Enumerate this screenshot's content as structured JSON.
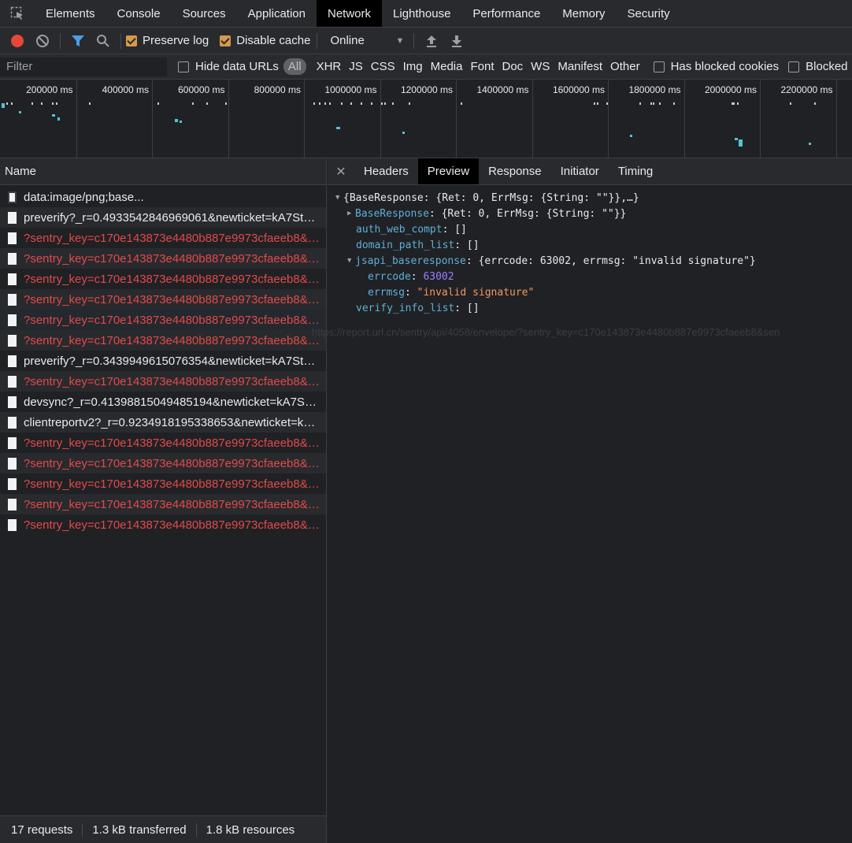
{
  "tabs": [
    "Elements",
    "Console",
    "Sources",
    "Application",
    "Network",
    "Lighthouse",
    "Performance",
    "Memory",
    "Security"
  ],
  "active_tab": "Network",
  "toolbar": {
    "preserve_log": "Preserve log",
    "disable_cache": "Disable cache",
    "throttle": "Online"
  },
  "filterbar": {
    "placeholder": "Filter",
    "hide_data_urls": "Hide data URLs",
    "types": [
      "All",
      "XHR",
      "JS",
      "CSS",
      "Img",
      "Media",
      "Font",
      "Doc",
      "WS",
      "Manifest",
      "Other"
    ],
    "has_blocked_cookies": "Has blocked cookies",
    "blocked": "Blocked"
  },
  "overview": {
    "labels": [
      "200000 ms",
      "400000 ms",
      "600000 ms",
      "800000 ms",
      "1000000 ms",
      "1200000 ms",
      "1400000 ms",
      "1600000 ms",
      "1800000 ms",
      "2000000 ms",
      "2200000 ms"
    ]
  },
  "requests": {
    "header": "Name",
    "rows": [
      {
        "name": "data:image/png;base...",
        "error": false
      },
      {
        "name": "preverify?_r=0.4933542846969061&newticket=kA7Sts6...",
        "error": false
      },
      {
        "name": "?sentry_key=c170e143873e4480b887e9973cfaeeb8&se...",
        "error": true
      },
      {
        "name": "?sentry_key=c170e143873e4480b887e9973cfaeeb8&se...",
        "error": true
      },
      {
        "name": "?sentry_key=c170e143873e4480b887e9973cfaeeb8&se...",
        "error": true
      },
      {
        "name": "?sentry_key=c170e143873e4480b887e9973cfaeeb8&se...",
        "error": true
      },
      {
        "name": "?sentry_key=c170e143873e4480b887e9973cfaeeb8&se...",
        "error": true
      },
      {
        "name": "?sentry_key=c170e143873e4480b887e9973cfaeeb8&se...",
        "error": true
      },
      {
        "name": "preverify?_r=0.3439949615076354&newticket=kA7Sts6...",
        "error": false
      },
      {
        "name": "?sentry_key=c170e143873e4480b887e9973cfaeeb8&se...",
        "error": true
      },
      {
        "name": "devsync?_r=0.41398815049485194&newticket=kA7Sts...",
        "error": false
      },
      {
        "name": "clientreportv2?_r=0.9234918195338653&newticket=kA...",
        "error": false
      },
      {
        "name": "?sentry_key=c170e143873e4480b887e9973cfaeeb8&se...",
        "error": true
      },
      {
        "name": "?sentry_key=c170e143873e4480b887e9973cfaeeb8&se...",
        "error": true
      },
      {
        "name": "?sentry_key=c170e143873e4480b887e9973cfaeeb8&se...",
        "error": true
      },
      {
        "name": "?sentry_key=c170e143873e4480b887e9973cfaeeb8&se...",
        "error": true
      },
      {
        "name": "?sentry_key=c170e143873e4480b887e9973cfaeeb8&se...",
        "error": true
      }
    ]
  },
  "status": {
    "requests": "17 requests",
    "transferred": "1.3 kB transferred",
    "resources": "1.8 kB resources"
  },
  "detail": {
    "tabs": [
      "Headers",
      "Preview",
      "Response",
      "Initiator",
      "Timing"
    ],
    "active": "Preview",
    "json": {
      "root": "{BaseResponse: {Ret: 0, ErrMsg: {String: \"\"}},…}",
      "base_key": "BaseResponse",
      "base_val": "{Ret: 0, ErrMsg: {String: \"\"}}",
      "auth_key": "auth_web_compt",
      "auth_val": "[]",
      "domain_key": "domain_path_list",
      "domain_val": "[]",
      "jsapi_key": "jsapi_baseresponse",
      "jsapi_val": "{errcode: 63002, errmsg: \"invalid signature\"}",
      "errcode_key": "errcode",
      "errcode_val": "63002",
      "errmsg_key": "errmsg",
      "errmsg_val": "\"invalid signature\"",
      "verify_key": "verify_info_list",
      "verify_val": "[]"
    }
  },
  "hover_tooltip": "https://report.url.cn/sentry/api/4058/envelope/?sentry_key=c170e143873e4480b887e9973cfaeeb8&sen"
}
